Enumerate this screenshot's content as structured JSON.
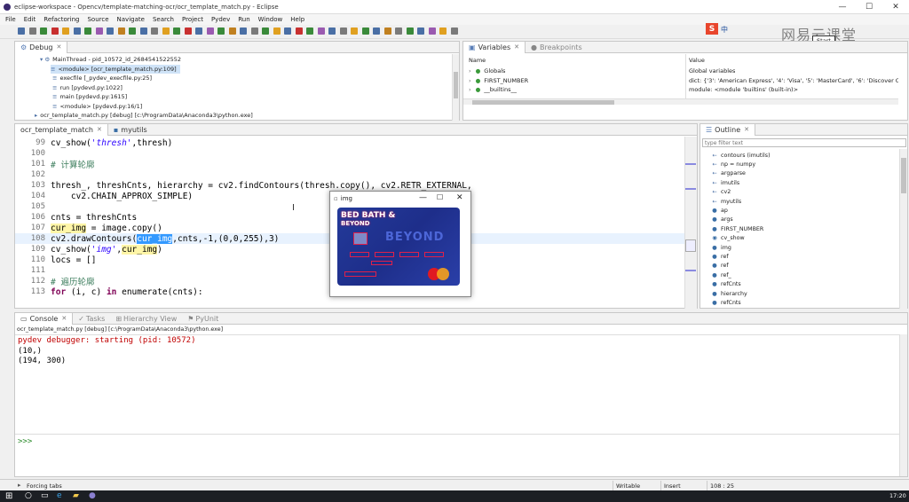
{
  "window": {
    "title": "eclipse-workspace - Opencv/template-matching-ocr/ocr_template_match.py - Eclipse",
    "minimize": "—",
    "maximize": "☐",
    "close": "✕"
  },
  "menu": [
    "File",
    "Edit",
    "Refactoring",
    "Source",
    "Navigate",
    "Search",
    "Project",
    "Pydev",
    "Run",
    "Window",
    "Help"
  ],
  "overlay": {
    "ime_label": "中",
    "watermark": "网易云课堂",
    "button": "Start"
  },
  "debug": {
    "tab": "Debug",
    "rows": [
      "MainThread - pid_10572_id_2684541522552",
      "<module> [ocr_template_match.py:109]",
      "execfile [_pydev_execfile.py:25]",
      "run [pydevd.py:1022]",
      "main [pydevd.py:1615]",
      "<module> [pydevd.py:16/1]",
      "ocr_template_match.py [debug] [c:\\ProgramData\\Anaconda3\\python.exe]"
    ]
  },
  "variables": {
    "tabs": [
      "Variables",
      "Breakpoints"
    ],
    "headers": [
      "Name",
      "Value"
    ],
    "rows": [
      {
        "name": "Globals",
        "value": "Global variables"
      },
      {
        "name": "FIRST_NUMBER",
        "value": "dict: {'3': 'American Express', '4': 'Visa', '5': 'MasterCard', '6': 'Discover Card'}"
      },
      {
        "name": "__builtins__",
        "value": "module: <module 'builtins' (built-in)>"
      }
    ]
  },
  "editor": {
    "tabs": [
      "ocr_template_match",
      "myutils"
    ],
    "lines": [
      {
        "n": "99",
        "parts": [
          {
            "t": "cv_show(",
            "c": ""
          },
          {
            "t": "'thresh'",
            "c": "str"
          },
          {
            "t": ",thresh)",
            "c": ""
          }
        ]
      },
      {
        "n": "100",
        "parts": [
          {
            "t": "",
            "c": ""
          }
        ]
      },
      {
        "n": "101",
        "parts": [
          {
            "t": "# 计算轮廓",
            "c": "comment"
          }
        ]
      },
      {
        "n": "102",
        "parts": [
          {
            "t": "",
            "c": ""
          }
        ]
      },
      {
        "n": "103",
        "parts": [
          {
            "t": "thresh_, threshCnts, hierarchy = cv2.findContours(thresh.copy(), cv2.RETR_EXTERNAL,",
            "c": ""
          }
        ]
      },
      {
        "n": "104",
        "parts": [
          {
            "t": "    cv2.CHAIN_APPROX_SIMPLE)",
            "c": ""
          }
        ]
      },
      {
        "n": "105",
        "parts": [
          {
            "t": "",
            "c": ""
          }
        ]
      },
      {
        "n": "106",
        "parts": [
          {
            "t": "cnts = threshCnts",
            "c": ""
          }
        ]
      },
      {
        "n": "107",
        "parts": [
          {
            "t": "cur_img",
            "c": "hl"
          },
          {
            "t": " = image.copy()",
            "c": ""
          }
        ]
      },
      {
        "n": "108",
        "parts": [
          {
            "t": "cv2.drawContours(",
            "c": ""
          },
          {
            "t": "cur_img",
            "c": "sel"
          },
          {
            "t": ",cnts,-1,(0,0,255),3)",
            "c": ""
          }
        ]
      },
      {
        "n": "109",
        "parts": [
          {
            "t": "cv_show(",
            "c": ""
          },
          {
            "t": "'img'",
            "c": "str"
          },
          {
            "t": ",",
            "c": ""
          },
          {
            "t": "cur_img",
            "c": "hl"
          },
          {
            "t": ")",
            "c": ""
          }
        ]
      },
      {
        "n": "110",
        "parts": [
          {
            "t": "locs = []",
            "c": ""
          }
        ]
      },
      {
        "n": "111",
        "parts": [
          {
            "t": "",
            "c": ""
          }
        ]
      },
      {
        "n": "112",
        "parts": [
          {
            "t": "# 遍历轮廓",
            "c": "comment"
          }
        ]
      },
      {
        "n": "113",
        "parts": [
          {
            "t": "for",
            "c": "kw"
          },
          {
            "t": " (i, c) ",
            "c": ""
          },
          {
            "t": "in",
            "c": "kw"
          },
          {
            "t": " enumerate(cnts):",
            "c": ""
          }
        ]
      }
    ]
  },
  "img_window": {
    "title": "img",
    "card_text_1": "BED BATH &",
    "card_text_2": "BEYOND",
    "card_text_3": "BEYOND"
  },
  "outline": {
    "tab": "Outline",
    "filter_placeholder": "type filter text",
    "items": [
      {
        "icon": "←",
        "label": "contours (imutils)"
      },
      {
        "icon": "←",
        "label": "np = numpy"
      },
      {
        "icon": "←",
        "label": "argparse"
      },
      {
        "icon": "←",
        "label": "imutils"
      },
      {
        "icon": "←",
        "label": "cv2"
      },
      {
        "icon": "←",
        "label": "myutils"
      },
      {
        "icon": "●",
        "label": "ap"
      },
      {
        "icon": "●",
        "label": "args"
      },
      {
        "icon": "●",
        "label": "FIRST_NUMBER"
      },
      {
        "icon": "◉",
        "label": "cv_show"
      },
      {
        "icon": "●",
        "label": "img"
      },
      {
        "icon": "●",
        "label": "ref"
      },
      {
        "icon": "●",
        "label": "ref"
      },
      {
        "icon": "●",
        "label": "ref_"
      },
      {
        "icon": "●",
        "label": "refCnts"
      },
      {
        "icon": "●",
        "label": "hierarchy"
      },
      {
        "icon": "●",
        "label": "refCnts"
      }
    ]
  },
  "console": {
    "tabs": [
      "Console",
      "Tasks",
      "Hierarchy View",
      "PyUnit"
    ],
    "subtitle": "ocr_template_match.py [debug] [c:\\ProgramData\\Anaconda3\\python.exe]",
    "lines": [
      "pydev debugger: starting (pid: 10572)",
      "(10,)",
      "(194, 300)"
    ],
    "prompt": ">>>"
  },
  "status": {
    "left": "Forcing tabs",
    "writable": "Writable",
    "insert": "Insert",
    "position": "108 : 25"
  },
  "taskbar": {
    "time": "17:20"
  },
  "colors": {
    "selection": "#3399ff",
    "highlight": "#fff6a8",
    "console_text": "#c00000",
    "string": "#2a00ff",
    "comment": "#3f7f5f",
    "keyword": "#7f0055"
  }
}
